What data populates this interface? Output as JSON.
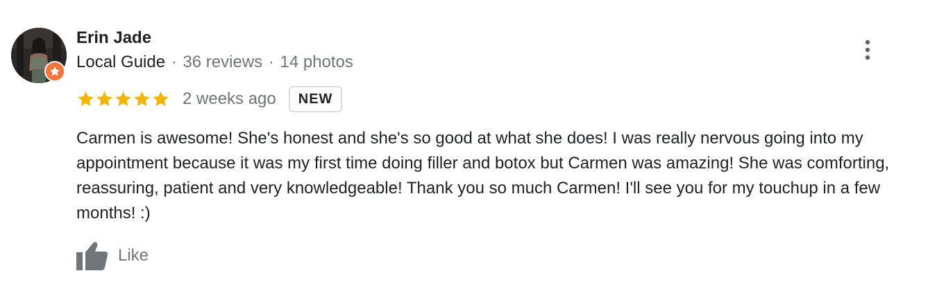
{
  "reviewer": {
    "name": "Erin Jade",
    "badge": "Local Guide",
    "separator": "·",
    "reviews": "36 reviews",
    "photos": "14 photos"
  },
  "rating": {
    "stars": 5,
    "max_stars": 5,
    "date": "2 weeks ago",
    "new_label": "NEW"
  },
  "review": {
    "text": "Carmen is awesome! She's honest and she's so good at what she does! I was really nervous going into my appointment because it was my first time doing filler and botox but Carmen was amazing! She was comforting, reassuring, patient and very knowledgeable! Thank you so much Carmen! I'll see you for my touchup in a few months! :)"
  },
  "actions": {
    "like_label": "Like"
  },
  "icons": {
    "more": "more-vert-icon",
    "like": "thumb-up-icon",
    "star": "star-icon",
    "guide": "local-guide-star-icon"
  },
  "colors": {
    "star": "#f5b400",
    "guide_badge": "#f4743b",
    "secondary_text": "#70757a",
    "primary_text": "#202124"
  }
}
